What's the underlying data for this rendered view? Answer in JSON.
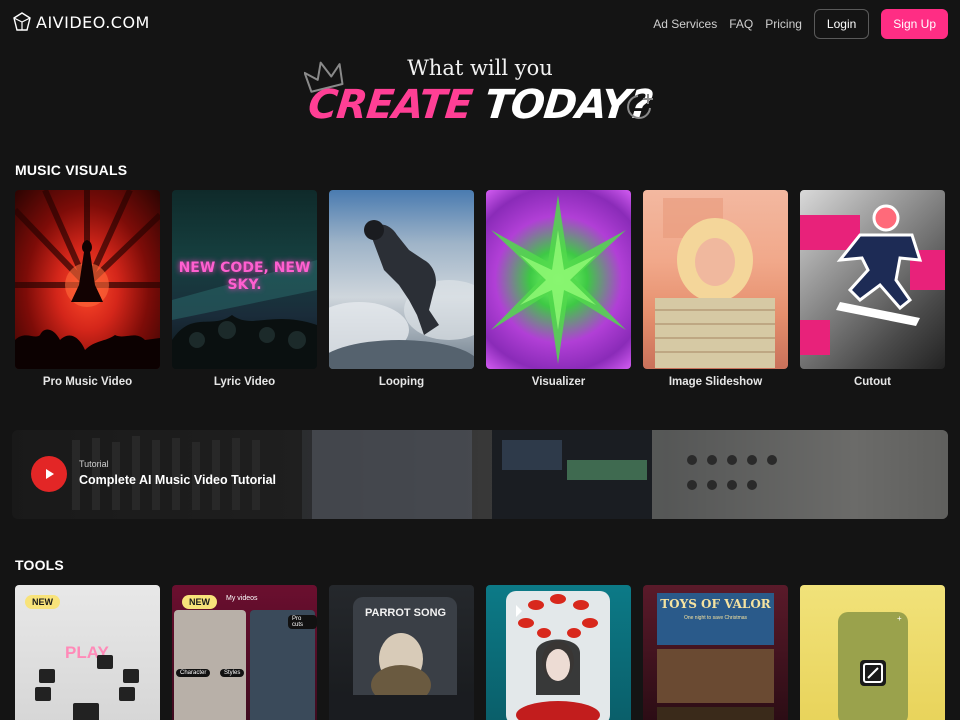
{
  "header": {
    "logo_text": "AIVIDEO.COM",
    "nav": [
      "Ad Services",
      "FAQ",
      "Pricing"
    ],
    "login_label": "Login",
    "signup_label": "Sign Up"
  },
  "hero": {
    "title": "What will you",
    "sub_pink": "CREATE",
    "sub_white": "TODAY?"
  },
  "music_visuals": {
    "title": "MUSIC VISUALS",
    "items": [
      {
        "label": "Pro Music Video"
      },
      {
        "label": "Lyric Video",
        "overlay": "NEW CODE, NEW SKY."
      },
      {
        "label": "Looping"
      },
      {
        "label": "Visualizer"
      },
      {
        "label": "Image Slideshow"
      },
      {
        "label": "Cutout"
      }
    ]
  },
  "tutorial": {
    "eyebrow": "Tutorial",
    "title": "Complete AI Music Video Tutorial"
  },
  "tools": {
    "title": "TOOLS",
    "badge": "NEW",
    "card1": {
      "text": "PLAY"
    },
    "card2": {
      "tab": "My videos",
      "chip1": "Character",
      "chip2": "Styles",
      "chip3": "Pro cuts"
    },
    "card3": {
      "text": "PARROT SONG"
    },
    "card5": {
      "title": "TOYS OF VALOR",
      "sub": "One night to save Christmas"
    }
  },
  "colors": {
    "accent": "#ff2d84",
    "background": "#141414",
    "play_button": "#e32626",
    "badge": "#f8e37a"
  }
}
